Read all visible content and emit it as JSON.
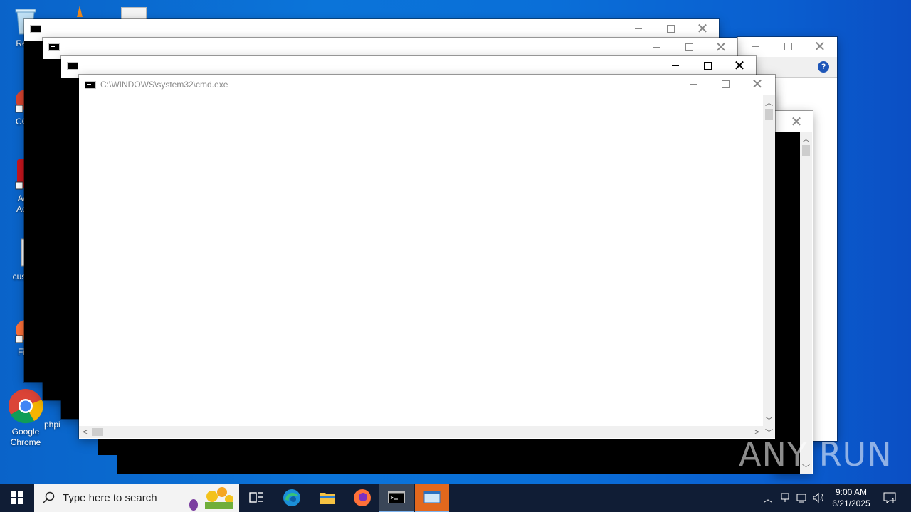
{
  "desktop": {
    "icons": [
      {
        "id": "recycle",
        "label": "Recy"
      },
      {
        "id": "ccleaner",
        "label": "CCl"
      },
      {
        "id": "acrobat",
        "label": "Ad\nAcr"
      },
      {
        "id": "custom",
        "label": "custo"
      },
      {
        "id": "firefox",
        "label": "Fir"
      },
      {
        "id": "chrome",
        "label": "Google\nChrome"
      },
      {
        "id": "php",
        "label": "phpi"
      }
    ]
  },
  "windows": {
    "front": {
      "title": "C:\\WINDOWS\\system32\\cmd.exe"
    },
    "back1": {
      "title": ""
    },
    "back2": {
      "title": ""
    },
    "back3": {
      "title": ""
    }
  },
  "taskbar": {
    "search_placeholder": "Type here to search",
    "time": "9:00 AM",
    "date": "6/21/2025",
    "notification_count": "1"
  },
  "watermark": "ANY RUN",
  "colors": {
    "accent": "#0b74d9",
    "taskbar": "#101d35"
  }
}
